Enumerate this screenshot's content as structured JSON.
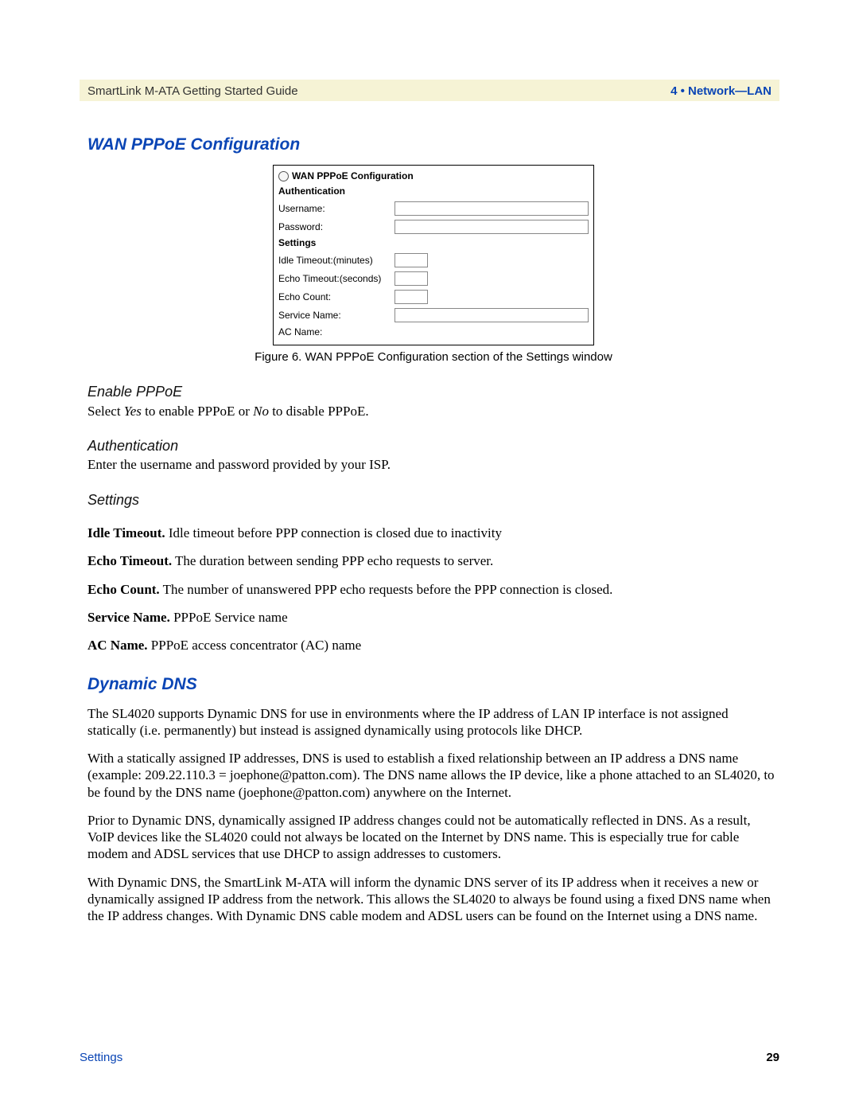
{
  "header": {
    "left": "SmartLink M-ATA Getting Started Guide",
    "right": "4 • Network—LAN"
  },
  "section1": {
    "title": "WAN PPPoE Configuration",
    "figure": {
      "panel_title": "WAN PPPoE Configuration",
      "auth_header": "Authentication",
      "username_label": "Username:",
      "password_label": "Password:",
      "settings_header": "Settings",
      "idle_label": "Idle Timeout:(minutes)",
      "echo_timeout_label": "Echo Timeout:(seconds)",
      "echo_count_label": "Echo Count:",
      "service_name_label": "Service Name:",
      "ac_name_label": "AC Name:",
      "caption": "Figure 6. WAN PPPoE Configuration section of the Settings window"
    },
    "sub1": {
      "title": "Enable PPPoE",
      "text_pre": "Select ",
      "yes": "Yes",
      "mid": " to enable PPPoE or ",
      "no": "No",
      "text_post": " to disable PPPoE."
    },
    "sub2": {
      "title": "Authentication",
      "text": "Enter the username and password provided by your ISP."
    },
    "sub3": {
      "title": "Settings"
    },
    "idle": {
      "bold": "Idle Timeout.",
      "text": " Idle timeout before PPP connection is closed due to inactivity"
    },
    "echo": {
      "bold": "Echo Timeout.",
      "text": " The duration between sending PPP echo requests to server."
    },
    "count": {
      "bold": "Echo Count.",
      "text": " The number of unanswered PPP echo requests before the PPP connection is closed."
    },
    "svc": {
      "bold": "Service Name.",
      "text": " PPPoE Service name"
    },
    "ac": {
      "bold": "AC Name.",
      "text": " PPPoE access concentrator (AC) name"
    }
  },
  "section2": {
    "title": "Dynamic DNS",
    "p1": "The SL4020 supports Dynamic DNS for use in environments where the IP address of LAN IP interface is not assigned statically (i.e. permanently) but instead is assigned dynamically using protocols like DHCP.",
    "p2": "With a statically assigned IP addresses, DNS is used to establish a fixed relationship between an IP address a DNS name (example: 209.22.110.3 = joephone@patton.com). The DNS name allows the IP device, like a phone attached to an SL4020, to be found by the DNS name (joephone@patton.com) anywhere on the Internet.",
    "p3": "Prior to Dynamic DNS, dynamically assigned IP address changes could not be automatically reflected in DNS. As a result, VoIP devices like the SL4020 could not always be located on the Internet by DNS name. This is especially true for cable modem and ADSL services that use DHCP to assign addresses to customers.",
    "p4": "With Dynamic DNS, the SmartLink M-ATA will inform the dynamic DNS server of its IP address when it receives a new or dynamically assigned IP address from the network. This allows the SL4020 to always be found using a fixed DNS name when the IP address changes. With Dynamic DNS cable modem and ADSL users can be found on the Internet using a DNS name."
  },
  "footer": {
    "left": "Settings",
    "right": "29"
  }
}
